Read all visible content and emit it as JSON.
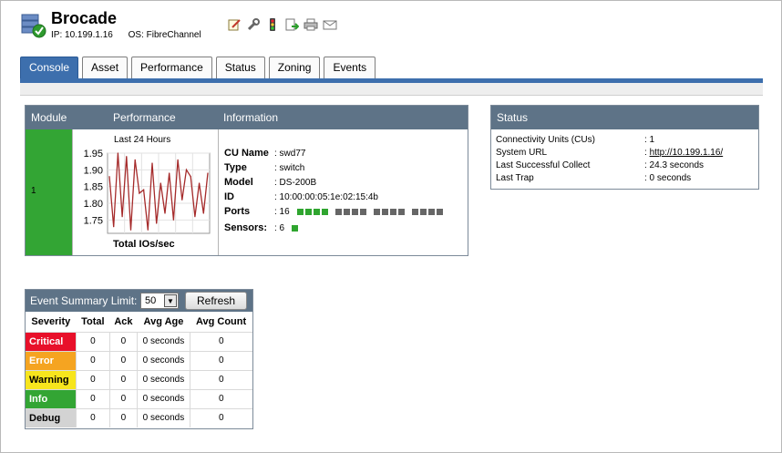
{
  "device": {
    "name": "Brocade",
    "ip_label": "IP: 10.199.1.16",
    "os_label": "OS: FibreChannel"
  },
  "toolbar": {
    "icons": [
      "edit-icon",
      "wrench-icon",
      "traffic-light-icon",
      "export-icon",
      "printer-icon",
      "email-icon"
    ]
  },
  "tabs": [
    "Console",
    "Asset",
    "Performance",
    "Status",
    "Zoning",
    "Events"
  ],
  "active_tab": "Console",
  "module_panel": {
    "headers": [
      "Module",
      "Performance",
      "Information"
    ],
    "module_id": "1",
    "perf_title": "Last 24 Hours",
    "perf_footer": "Total IOs/sec",
    "info": {
      "cu_name_label": "CU Name",
      "cu_name": ": swd77",
      "type_label": "Type",
      "type": ": switch",
      "model_label": "Model",
      "model": ": DS-200B",
      "id_label": "ID",
      "id": ": 10:00:00:05:1e:02:15:4b",
      "ports_label": "Ports",
      "ports": ": 16",
      "sensors_label": "Sensors:",
      "sensors": ": 6"
    }
  },
  "chart_data": {
    "type": "line",
    "title": "Last 24 Hours",
    "xlabel": "Total IOs/sec",
    "ylabel": "",
    "yticks": [
      "1.95",
      "1.90",
      "1.85",
      "1.80",
      "1.75"
    ],
    "ylim": [
      1.71,
      1.95
    ],
    "series": [
      {
        "values": [
          1.88,
          1.73,
          1.95,
          1.76,
          1.94,
          1.72,
          1.93,
          1.83,
          1.84,
          1.72,
          1.92,
          1.74,
          1.86,
          1.77,
          1.89,
          1.75,
          1.93,
          1.81,
          1.9,
          1.88,
          1.76,
          1.86,
          1.77,
          1.89
        ]
      }
    ],
    "color": "#a52a2a"
  },
  "status_panel": {
    "title": "Status",
    "rows": [
      {
        "label": "Connectivity Units (CUs)",
        "value": ": 1"
      },
      {
        "label": "System URL",
        "value": "http://10.199.1.16/"
      },
      {
        "label": "Last Successful Collect",
        "value": ": 24.3 seconds"
      },
      {
        "label": "Last Trap",
        "value": ": 0 seconds"
      }
    ],
    "url_prefix": ": "
  },
  "events": {
    "title": "Event Summary",
    "limit_label": "Limit:",
    "limit_value": "50",
    "refresh_label": "Refresh",
    "columns": [
      "Severity",
      "Total",
      "Ack",
      "Avg Age",
      "Avg Count"
    ],
    "rows": [
      {
        "severity": "Critical",
        "color": "#e8102a",
        "text_color": "#ffffff",
        "total": "0",
        "ack": "0",
        "avg_age": "0 seconds",
        "avg_count": "0"
      },
      {
        "severity": "Error",
        "color": "#f5a421",
        "text_color": "#ffffff",
        "total": "0",
        "ack": "0",
        "avg_age": "0 seconds",
        "avg_count": "0"
      },
      {
        "severity": "Warning",
        "color": "#f7e51d",
        "text_color": "#000000",
        "total": "0",
        "ack": "0",
        "avg_age": "0 seconds",
        "avg_count": "0"
      },
      {
        "severity": "Info",
        "color": "#33a534",
        "text_color": "#ffffff",
        "total": "0",
        "ack": "0",
        "avg_age": "0 seconds",
        "avg_count": "0"
      },
      {
        "severity": "Debug",
        "color": "#d3d3d3",
        "text_color": "#000000",
        "total": "0",
        "ack": "0",
        "avg_age": "0 seconds",
        "avg_count": "0"
      }
    ]
  },
  "colors": {
    "accent": "#3d6fad",
    "panel_header": "#5e7387",
    "module_green": "#33a534",
    "port_green": "#2fa52f",
    "port_gray": "#666666"
  },
  "ports_state": {
    "active": 4,
    "total": 16,
    "sensors_active": 1
  }
}
